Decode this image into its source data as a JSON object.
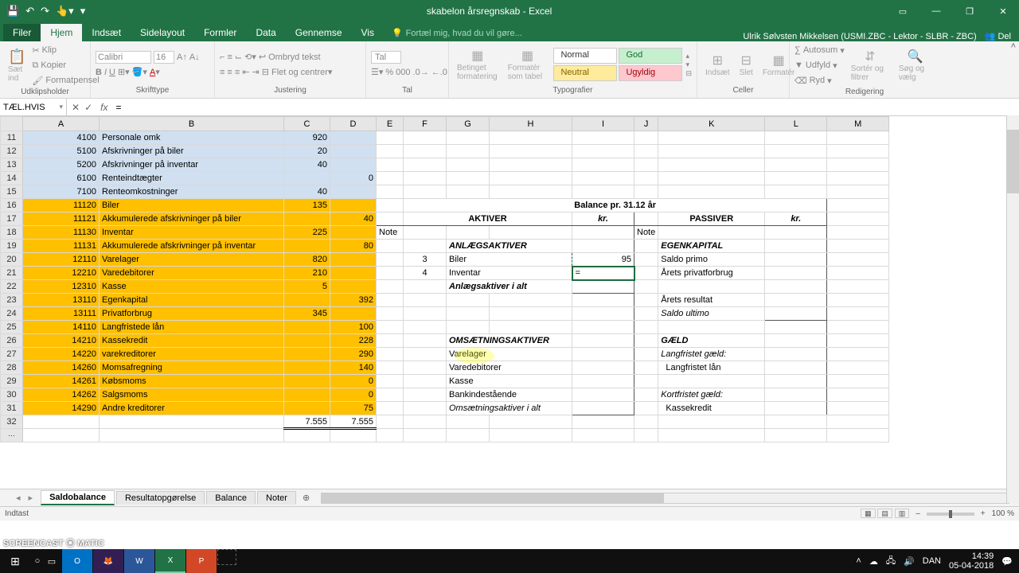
{
  "title": "skabelon årsregnskab - Excel",
  "user_name": "Ulrik Sølvsten Mikkelsen (USMI.ZBC - Lektor - SLBR - ZBC)",
  "share_label": "Del",
  "ribbon_tabs": {
    "file": "Filer",
    "home": "Hjem",
    "insert": "Indsæt",
    "page_layout": "Sidelayout",
    "formulas": "Formler",
    "data": "Data",
    "review": "Gennemse",
    "view": "Vis",
    "tell_me": "Fortæl mig, hvad du vil gøre..."
  },
  "ribbon_groups": {
    "clipboard": {
      "label": "Udklipsholder",
      "cut": "Klip",
      "copy": "Kopier",
      "painter": "Formatpensel",
      "paste": "Sæt ind"
    },
    "font": {
      "label": "Skrifttype",
      "name": "Calibri",
      "size": "16"
    },
    "alignment": {
      "label": "Justering",
      "wrap": "Ombryd tekst",
      "merge": "Flet og centrer"
    },
    "number": {
      "label": "Tal",
      "format": "Tal"
    },
    "styles": {
      "conditional": "Betinget formatering",
      "as_table": "Formatér som tabel",
      "normal": "Normal",
      "good": "God",
      "neutral": "Neutral",
      "bad": "Ugyldig",
      "label": "Typografier"
    },
    "cells": {
      "insert": "Indsæt",
      "delete": "Slet",
      "format": "Formatér",
      "label": "Celler"
    },
    "editing": {
      "autosum": "Autosum",
      "fill": "Udfyld",
      "clear": "Ryd",
      "sort": "Sortér og filtrer",
      "find": "Søg og vælg",
      "label": "Redigering"
    }
  },
  "name_box": "TÆL.HVIS",
  "formula": "=",
  "columns": [
    "A",
    "B",
    "C",
    "D",
    "E",
    "F",
    "G",
    "H",
    "I",
    "J",
    "K",
    "L",
    "M"
  ],
  "rows": [
    {
      "n": 11,
      "cls": "blue",
      "a": "4100",
      "b": "Personale omk",
      "c": "920",
      "d": ""
    },
    {
      "n": 12,
      "cls": "blue",
      "a": "5100",
      "b": "Afskrivninger på biler",
      "c": "20",
      "d": ""
    },
    {
      "n": 13,
      "cls": "blue",
      "a": "5200",
      "b": "Afskrivninger på inventar",
      "c": "40",
      "d": ""
    },
    {
      "n": 14,
      "cls": "blue",
      "a": "6100",
      "b": "Renteindtægter",
      "c": "",
      "d": "0"
    },
    {
      "n": 15,
      "cls": "blue",
      "a": "7100",
      "b": "Renteomkostninger",
      "c": "40",
      "d": ""
    },
    {
      "n": 16,
      "cls": "yel",
      "a": "11120",
      "b": "Biler",
      "c": "135",
      "d": ""
    },
    {
      "n": 17,
      "cls": "yel",
      "a": "11121",
      "b": "Akkumulerede afskrivninger på biler",
      "c": "",
      "d": "40"
    },
    {
      "n": 18,
      "cls": "yel",
      "a": "11130",
      "b": "Inventar",
      "c": "225",
      "d": ""
    },
    {
      "n": 19,
      "cls": "yel",
      "a": "11131",
      "b": "Akkumulerede afskrivninger på inventar",
      "c": "",
      "d": "80"
    },
    {
      "n": 20,
      "cls": "yel",
      "a": "12110",
      "b": "Varelager",
      "c": "820",
      "d": ""
    },
    {
      "n": 21,
      "cls": "yel",
      "a": "12210",
      "b": "Varedebitorer",
      "c": "210",
      "d": ""
    },
    {
      "n": 22,
      "cls": "yel",
      "a": "12310",
      "b": "Kasse",
      "c": "5",
      "d": ""
    },
    {
      "n": 23,
      "cls": "yel",
      "a": "13110",
      "b": "Egenkapital",
      "c": "",
      "d": "392"
    },
    {
      "n": 24,
      "cls": "yel",
      "a": "13111",
      "b": "Privatforbrug",
      "c": "345",
      "d": ""
    },
    {
      "n": 25,
      "cls": "yel",
      "a": "14110",
      "b": "Langfristede lån",
      "c": "",
      "d": "100"
    },
    {
      "n": 26,
      "cls": "yel",
      "a": "14210",
      "b": "Kassekredit",
      "c": "",
      "d": "228"
    },
    {
      "n": 27,
      "cls": "yel",
      "a": "14220",
      "b": "varekreditorer",
      "c": "",
      "d": "290"
    },
    {
      "n": 28,
      "cls": "yel",
      "a": "14260",
      "b": "Momsafregning",
      "c": "",
      "d": "140"
    },
    {
      "n": 29,
      "cls": "yel",
      "a": "14261",
      "b": "Købsmoms",
      "c": "",
      "d": "0"
    },
    {
      "n": 30,
      "cls": "yel",
      "a": "14262",
      "b": "Salgsmoms",
      "c": "",
      "d": "0"
    },
    {
      "n": 31,
      "cls": "yel",
      "a": "14290",
      "b": "Andre kreditorer",
      "c": "",
      "d": "75"
    }
  ],
  "totals": {
    "c": "7.555",
    "d": "7.555"
  },
  "balance": {
    "title": "Balance pr. 31.12 år",
    "aktiver": "AKTIVER",
    "passiver": "PASSIVER",
    "kr": "kr.",
    "note": "Note",
    "anlaeg": "ANLÆGSAKTIVER",
    "egen": "EGENKAPITAL",
    "biler": "Biler",
    "biler_note": "3",
    "biler_val": "95",
    "inventar": "Inventar",
    "inventar_note": "4",
    "inventar_val": "=",
    "saldo_primo": "Saldo primo",
    "privatforbrug": "Årets privatforbrug",
    "anlaeg_total": "Anlægsaktiver i alt",
    "resultat": "Årets resultat",
    "saldo_ultimo": "Saldo ultimo",
    "omsaet": "OMSÆTNINGSAKTIVER",
    "gaeld": "GÆLD",
    "varelager": "Varelager",
    "varedeb": "Varedebitorer",
    "kasse": "Kasse",
    "bank": "Bankindestående",
    "omsaet_total": "Omsætningsaktiver i alt",
    "langfrist": "Langfristet gæld:",
    "langfrist_laan": "Langfristet lån",
    "kortfrist": "Kortfristet gæld:",
    "kassekredit": "Kassekredit"
  },
  "sheet_tabs": [
    "Saldobalance",
    "Resultatopgørelse",
    "Balance",
    "Noter"
  ],
  "status": "Indtast",
  "zoom": "100 %",
  "tray": {
    "lang": "DAN",
    "time": "14:39",
    "date": "05-04-2018"
  },
  "screencast": "SCREENCAST ⦿ MATIC"
}
